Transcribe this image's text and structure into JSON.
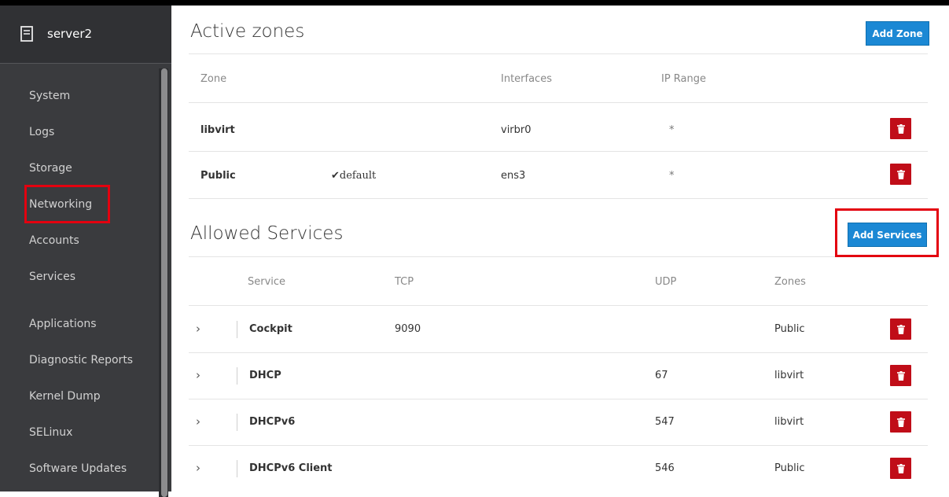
{
  "host": {
    "name": "server2",
    "icon": "server-icon"
  },
  "nav": [
    {
      "label": "System"
    },
    {
      "label": "Logs"
    },
    {
      "label": "Storage"
    },
    {
      "label": "Networking"
    },
    {
      "label": "Accounts"
    },
    {
      "label": "Services"
    },
    {
      "label": "Applications"
    },
    {
      "label": "Diagnostic Reports"
    },
    {
      "label": "Kernel Dump"
    },
    {
      "label": "SELinux"
    },
    {
      "label": "Software Updates"
    }
  ],
  "zones": {
    "title": "Active zones",
    "add_label": "Add Zone",
    "headers": {
      "zone": "Zone",
      "interfaces": "Interfaces",
      "ip_range": "IP Range"
    },
    "rows": [
      {
        "name": "libvirt",
        "tag": "",
        "interfaces": "virbr0",
        "ip_range": "*"
      },
      {
        "name": "Public",
        "tag": "✔default",
        "interfaces": "ens3",
        "ip_range": "*"
      }
    ]
  },
  "services": {
    "title": "Allowed Services",
    "add_label": "Add Services",
    "headers": {
      "service": "Service",
      "tcp": "TCP",
      "udp": "UDP",
      "zones": "Zones"
    },
    "rows": [
      {
        "name": "Cockpit",
        "tcp": "9090",
        "udp": "",
        "zones": "Public"
      },
      {
        "name": "DHCP",
        "tcp": "",
        "udp": "67",
        "zones": "libvirt"
      },
      {
        "name": "DHCPv6",
        "tcp": "",
        "udp": "547",
        "zones": "libvirt"
      },
      {
        "name": "DHCPv6 Client",
        "tcp": "",
        "udp": "546",
        "zones": "Public"
      }
    ]
  },
  "colors": {
    "accent": "#1b88d4",
    "danger": "#c00d18",
    "highlight": "#e3000f",
    "sidebar": "#3a3b3e"
  }
}
